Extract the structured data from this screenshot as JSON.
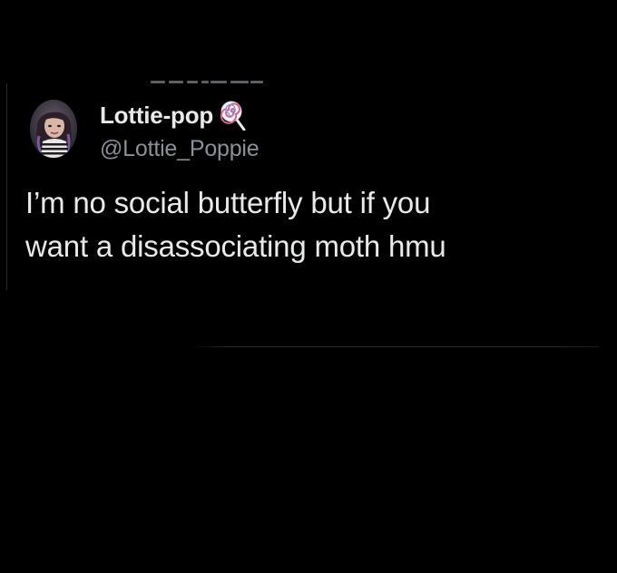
{
  "tweet": {
    "display_name": "Lottie-pop",
    "badge_icon": "lollipop-icon",
    "handle": "@Lottie_Poppie",
    "text_lines": [
      "I’m no social butterfly but if you",
      "want a disassociating moth hmu"
    ]
  },
  "colors": {
    "background": "#000000",
    "name": "#e9e9e9",
    "handle": "#8b9096",
    "text": "#e7e9ea",
    "divider": "#2e2e2e"
  }
}
